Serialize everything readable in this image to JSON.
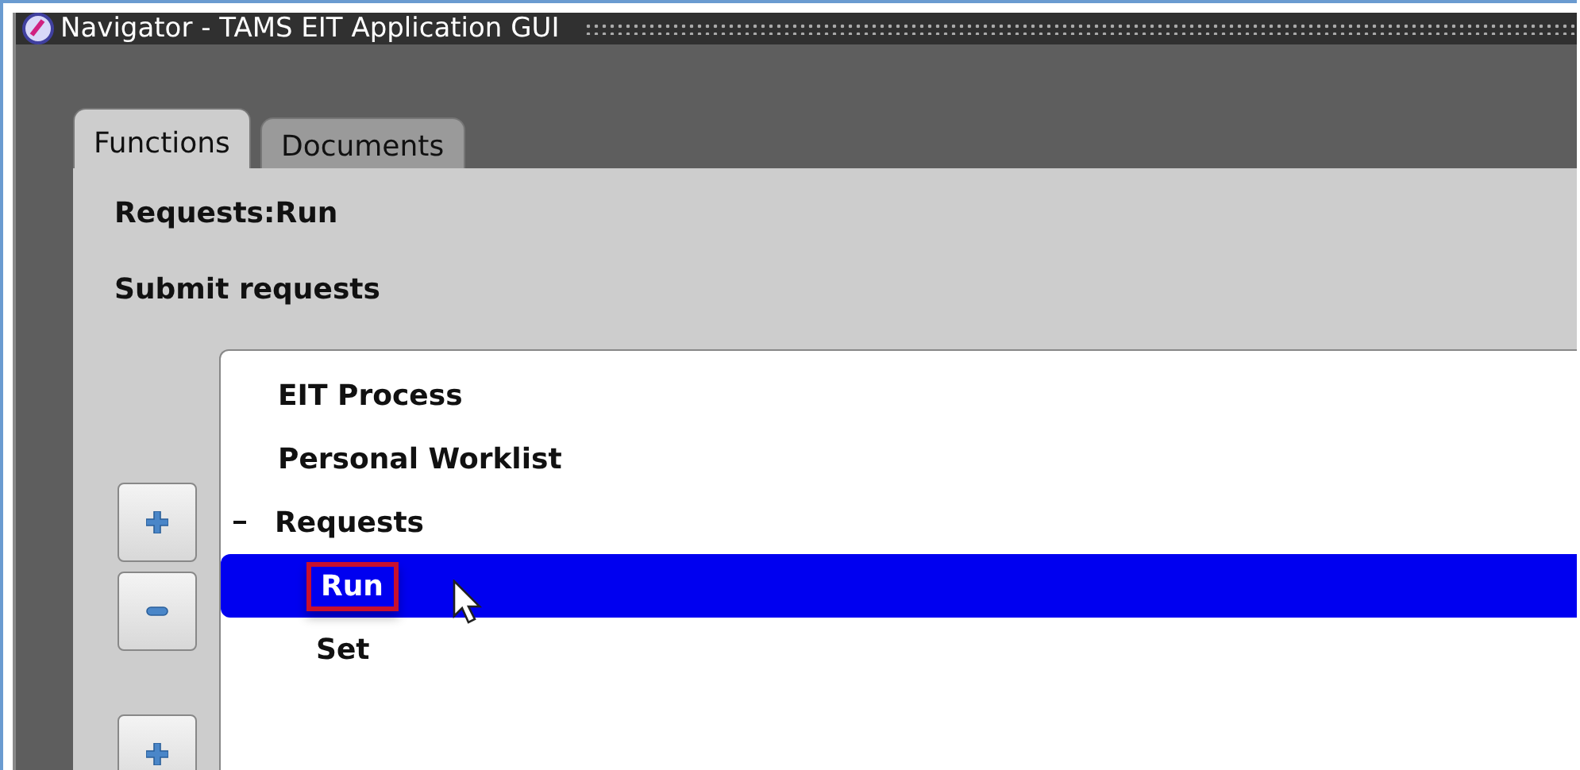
{
  "window": {
    "title": "Navigator - TAMS EIT Application GUI"
  },
  "tabs": [
    {
      "label": "Functions",
      "selected": true
    },
    {
      "label": "Documents",
      "selected": false
    }
  ],
  "heading": "Requests:Run",
  "description": "Submit requests",
  "tree": [
    {
      "label": "EIT Process",
      "selected": false
    },
    {
      "label": "Personal Worklist",
      "selected": false
    },
    {
      "label": "Requests",
      "selected": false,
      "expanded": true,
      "children": [
        {
          "label": "Run",
          "selected": true,
          "highlighted": true
        },
        {
          "label": "Set",
          "selected": false
        }
      ]
    }
  ],
  "side_buttons": [
    {
      "kind": "expand"
    },
    {
      "kind": "collapse"
    },
    {
      "kind": "expand"
    }
  ]
}
